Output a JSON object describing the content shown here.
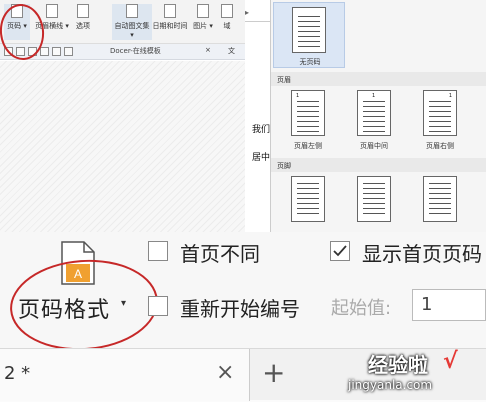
{
  "ribbon": {
    "items": [
      {
        "label": "页码 ▾",
        "icon": "page-number-icon",
        "selected": true
      },
      {
        "label": "页眉横线 ▾",
        "icon": "header-line-icon"
      },
      {
        "label": "选项",
        "icon": "options-icon"
      },
      {
        "label": "自动图文集 ▾",
        "icon": "autotext-icon"
      },
      {
        "label": "日期和时间",
        "icon": "calendar-icon"
      },
      {
        "label": "图片 ▾",
        "icon": "picture-icon"
      },
      {
        "label": "域",
        "icon": "field-icon"
      }
    ]
  },
  "quickbar": {
    "tab": "Docer-在线模板",
    "close": "×",
    "extra": "文"
  },
  "rightdoc": {
    "lines": [
      "我们",
      "居中"
    ],
    "tabmark": "▸"
  },
  "gallery": {
    "none_label": "无页码",
    "header_section": "页眉",
    "footer_section": "页脚",
    "header_items": [
      "页眉左侧",
      "页眉中间",
      "页眉右侧"
    ],
    "page_num": "1"
  },
  "bottom": {
    "format_label": "页码格式",
    "format_arrow": "▾",
    "first_diff": "首页不同",
    "show_first": "显示首页页码",
    "restart": "重新开始编号",
    "start_label": "起始值:",
    "start_value": "1",
    "tab_title": "2 *",
    "tab_close": "×",
    "tab_add": "+"
  },
  "watermark": {
    "line1": "经验啦",
    "line2": "jingyanla.com",
    "check": "√"
  },
  "colors": {
    "accent": "#f0a030",
    "annotation": "#c62828",
    "selected": "#dbe6f5"
  }
}
